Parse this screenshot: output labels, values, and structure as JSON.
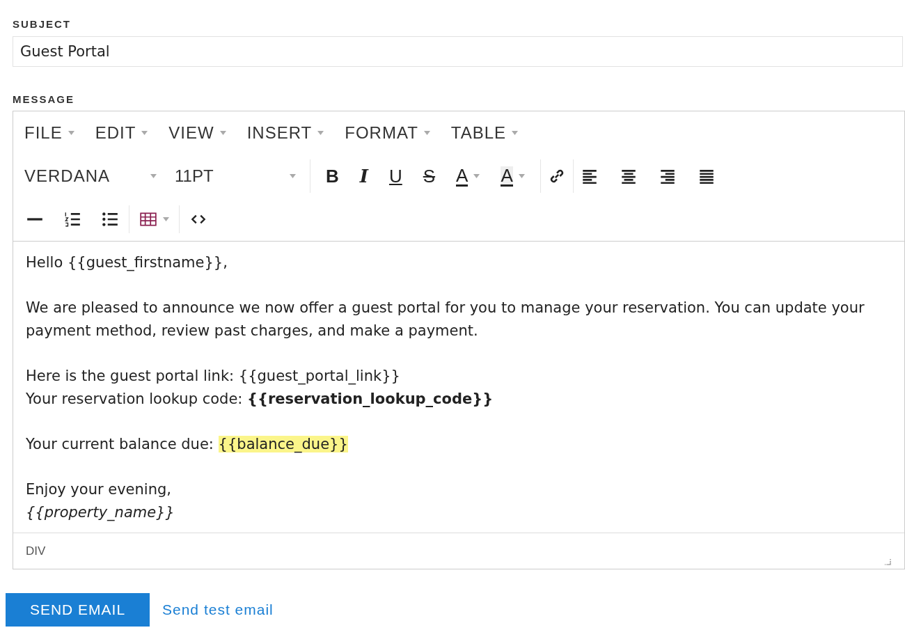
{
  "subject": {
    "label": "SUBJECT",
    "value": "Guest Portal"
  },
  "message": {
    "label": "MESSAGE",
    "menu": [
      {
        "label": "FILE"
      },
      {
        "label": "EDIT"
      },
      {
        "label": "VIEW"
      },
      {
        "label": "INSERT"
      },
      {
        "label": "FORMAT"
      },
      {
        "label": "TABLE"
      }
    ],
    "font": {
      "value": "VERDANA"
    },
    "size": {
      "value": "11PT"
    },
    "format_buttons": [
      {
        "kind": "bold",
        "label": "B"
      },
      {
        "kind": "italic",
        "label": "I"
      },
      {
        "kind": "underline",
        "label": "U"
      },
      {
        "kind": "strike",
        "label": "S"
      },
      {
        "kind": "textcolor",
        "label": "A"
      },
      {
        "kind": "bgcolor",
        "label": "A"
      }
    ],
    "tools": [
      {
        "kind": "link"
      },
      {
        "kind": "align-left"
      },
      {
        "kind": "align-center"
      },
      {
        "kind": "align-right"
      },
      {
        "kind": "justify"
      }
    ],
    "tools_row2": [
      {
        "kind": "hr"
      },
      {
        "kind": "numbered"
      },
      {
        "kind": "bullets"
      },
      {
        "kind": "table"
      },
      {
        "kind": "code"
      }
    ],
    "body": [
      [
        [
          {
            "kind": "plain",
            "text": "Hello {{guest_firstname}},"
          }
        ]
      ],
      [
        [
          {
            "kind": "plain",
            "text": "We are pleased to announce we now offer a guest portal for you to manage your reservation. You can update your payment method, review past charges, and make a payment."
          }
        ]
      ],
      [
        [
          {
            "kind": "plain",
            "text": "Here is the guest portal link: {{guest_portal_link}}"
          }
        ],
        [
          {
            "kind": "plain",
            "text": "Your reservation lookup code: "
          },
          {
            "kind": "bold",
            "text": "{{reservation_lookup_code}}"
          }
        ]
      ],
      [
        [
          {
            "kind": "plain",
            "text": "Your current balance due: "
          },
          {
            "kind": "highlight",
            "text": "{{balance_due}}"
          }
        ]
      ],
      [
        [
          {
            "kind": "plain",
            "text": "Enjoy your evening,"
          }
        ],
        [
          {
            "kind": "italic",
            "text": "{{property_name}}"
          }
        ]
      ]
    ],
    "path": "DIV"
  },
  "actions": {
    "send": "SEND EMAIL",
    "test": "Send test email"
  }
}
